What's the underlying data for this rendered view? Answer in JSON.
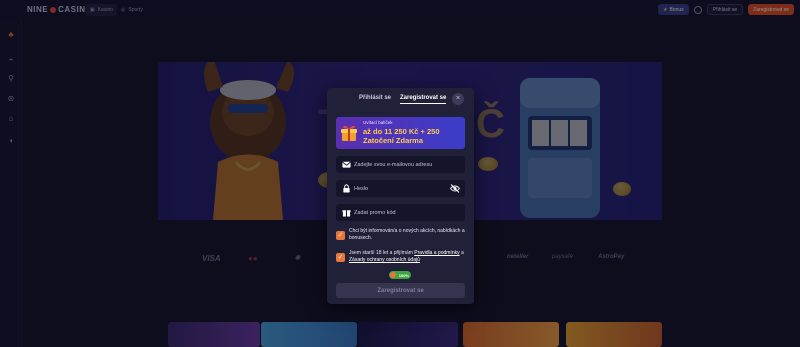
{
  "header": {
    "logo_left": "NINE",
    "logo_right": "CASINO",
    "nav": [
      {
        "label": "Kasino",
        "icon": "slot-machine-icon"
      },
      {
        "label": "Sporty",
        "icon": "soccer-ball-icon"
      }
    ],
    "bonus_label": "Bonus",
    "login_label": "Přihlásit se",
    "register_label": "Zaregistrovat se"
  },
  "sidebar": {
    "icons": [
      "home-icon",
      "charts-icon",
      "sports-icon",
      "soccer-icon",
      "racing-icon",
      "support-icon"
    ]
  },
  "payments": [
    "VISA",
    "Mastercard",
    "",
    "",
    "",
    "paysafe",
    "neteller",
    "AstroPay"
  ],
  "modal": {
    "tab_login": "Přihlásit se",
    "tab_register": "Zaregistrovat se",
    "close_symbol": "×",
    "bonus": {
      "caption": "Uvítací balíček",
      "headline": "až do 11 250 Kč + 250 Zatočení Zdarma"
    },
    "email": {
      "placeholder": "Zadejte svou e-mailovou adresu",
      "value": ""
    },
    "password": {
      "placeholder": "Heslo",
      "value": ""
    },
    "promo": {
      "placeholder": "Zadat promo kód",
      "value": ""
    },
    "newsletter_checked": true,
    "newsletter_text": "Chci být informován/a o nových akcích, nabídkách a bonusech.",
    "terms_checked": true,
    "terms_prefix": "Jsem starší 18 let a přijímám ",
    "terms_link1": "Pravidla a podmínky",
    "terms_mid": " a ",
    "terms_link2": "Zásady ochrany osobních údajů",
    "progress_label": "100%",
    "progress_value": 1.0,
    "submit_label": "Zaregistrovat se"
  },
  "colors": {
    "accent_orange": "#e8763a",
    "register_button": "#e24f1f",
    "bonus_gradient_start": "#5a2fb0",
    "bonus_gradient_end": "#3b3dc8",
    "bonus_text": "#ffc94a",
    "progress_green": "#3ca73f"
  }
}
